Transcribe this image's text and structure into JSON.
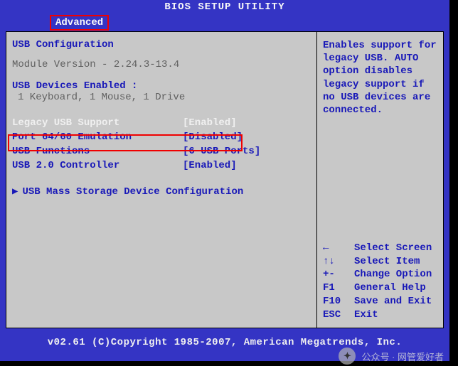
{
  "header": {
    "title": "BIOS SETUP UTILITY",
    "active_tab": "Advanced"
  },
  "left": {
    "section_title": "USB Configuration",
    "module_version": "Module Version - 2.24.3-13.4",
    "devices_head": "USB Devices Enabled :",
    "devices_line": "1 Keyboard, 1 Mouse, 1 Drive",
    "options": [
      {
        "label": "Legacy USB Support",
        "value": "[Enabled]",
        "selected": true
      },
      {
        "label": "Port 64/60 Emulation",
        "value": "[Disabled]",
        "selected": false
      },
      {
        "label": "USB Functions",
        "value": "[6 USB Ports]",
        "selected": false
      },
      {
        "label": "USB 2.0 Controller",
        "value": "[Enabled]",
        "selected": false
      }
    ],
    "submenu": "USB Mass Storage Device Configuration",
    "submenu_arrow": "▶"
  },
  "right": {
    "help": "Enables support for legacy USB. AUTO option disables legacy support if no USB devices are connected.",
    "keys": [
      {
        "k": "←",
        "d": "Select Screen"
      },
      {
        "k": "↑↓",
        "d": "Select Item"
      },
      {
        "k": "+-",
        "d": "Change Option"
      },
      {
        "k": "F1",
        "d": "General Help"
      },
      {
        "k": "F10",
        "d": "Save and Exit"
      },
      {
        "k": "ESC",
        "d": "Exit"
      }
    ]
  },
  "footer": "v02.61 (C)Copyright 1985-2007, American Megatrends, Inc.",
  "watermark": "公众号 · 网管爱好者"
}
